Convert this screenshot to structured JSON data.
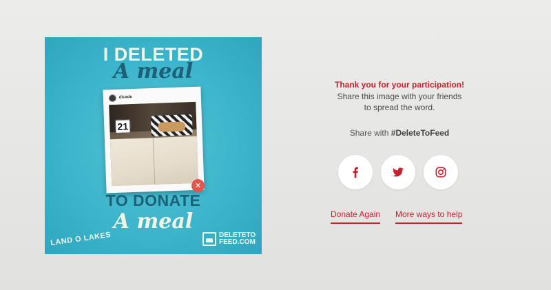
{
  "poster": {
    "headline_top": "I DELETED",
    "headline_meal_1": "A meal",
    "headline_bottom": "TO DONATE",
    "headline_meal_2": "A meal",
    "polaroid_user": "dlcade",
    "table_number": "21",
    "close_symbol": "✕",
    "brand_left": "LAND O LAKES",
    "brand_right_line1": "DELETETO",
    "brand_right_line2": "FEED.COM",
    "colors": {
      "background": "#3db5cb",
      "dark_text": "#1e5f78",
      "light_text": "#f4f4e4",
      "close_badge": "#e4554d"
    }
  },
  "panel": {
    "thanks": "Thank you for your participation!",
    "message_line1": "Share this image with your friends",
    "message_line2": "to spread the word.",
    "share_prefix": "Share with",
    "share_hashtag": "#DeleteToFeed",
    "social": [
      {
        "name": "facebook",
        "icon": "facebook-icon"
      },
      {
        "name": "twitter",
        "icon": "twitter-icon"
      },
      {
        "name": "instagram",
        "icon": "instagram-icon"
      }
    ],
    "donate_again": "Donate Again",
    "more_ways": "More ways to help",
    "accent_color": "#c8202e"
  }
}
